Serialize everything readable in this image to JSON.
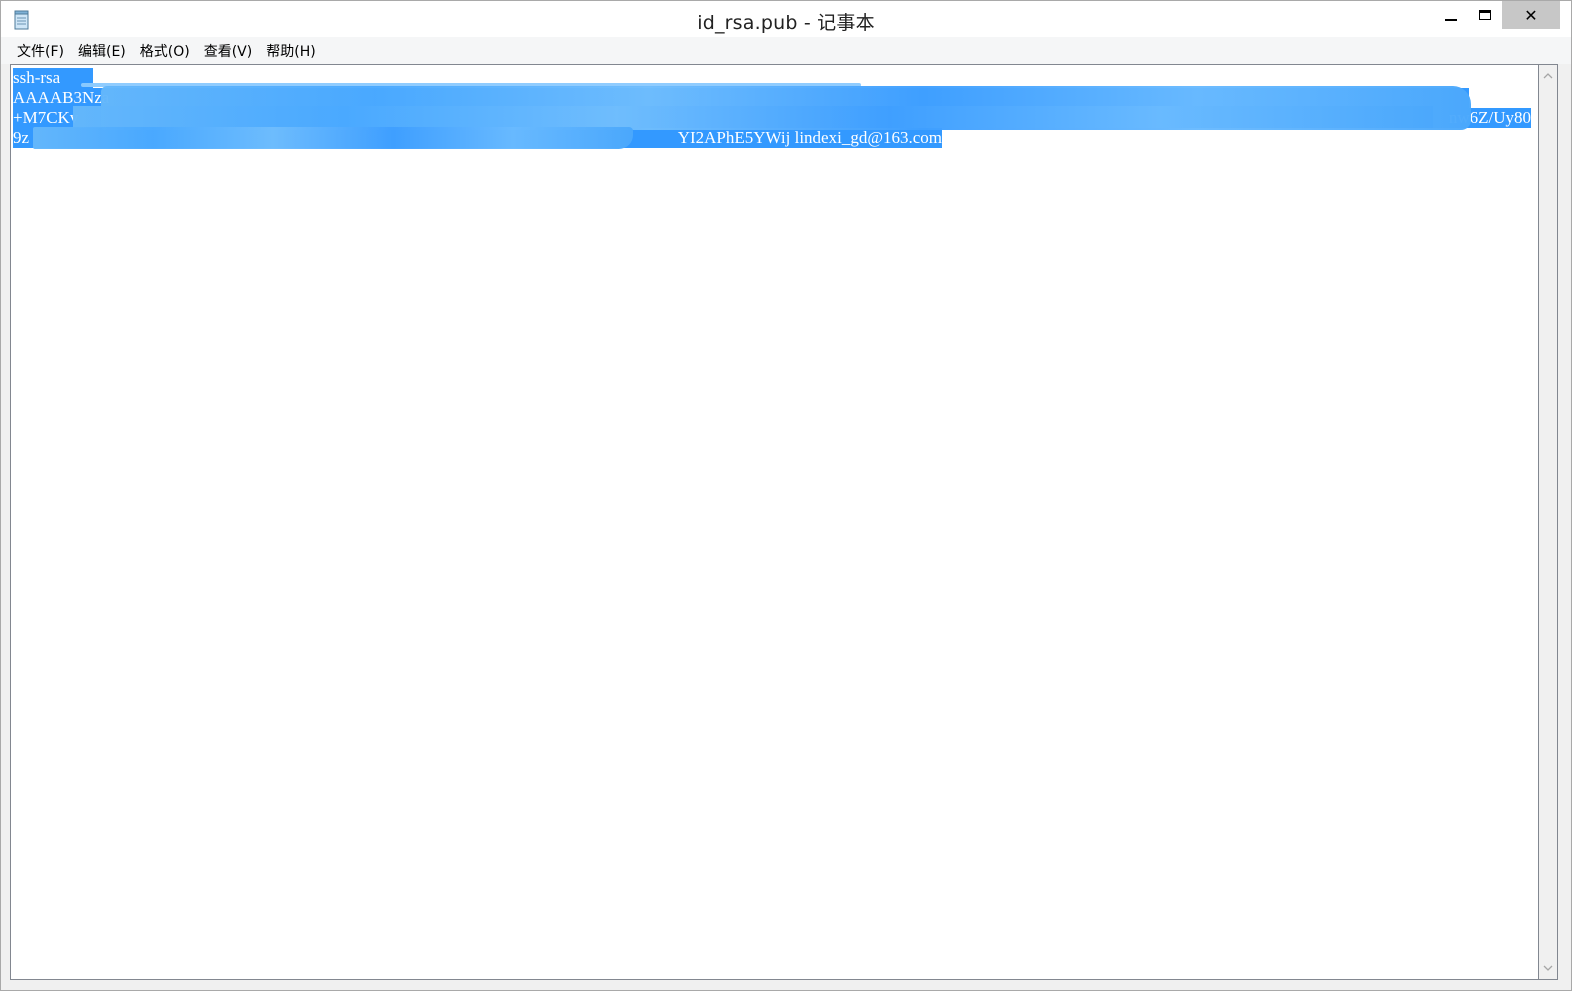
{
  "window": {
    "title": "id_rsa.pub - 记事本",
    "icon": "notepad-icon",
    "controls": {
      "minimize_icon": "minimize-icon",
      "maximize_icon": "maximize-icon",
      "close_label": "✕"
    }
  },
  "menu": {
    "items": [
      {
        "label": "文件(F)"
      },
      {
        "label": "编辑(E)"
      },
      {
        "label": "格式(O)"
      },
      {
        "label": "查看(V)"
      },
      {
        "label": "帮助(H)"
      }
    ]
  },
  "editor": {
    "lines": [
      {
        "left": "ssh-rsa",
        "right": ""
      },
      {
        "left": "AAAAB3Nza",
        "right": ""
      },
      {
        "left": "+M7CKv",
        "right": "nw6Z/Uy80"
      },
      {
        "left": "9z",
        "right": "YI2APhE5YWij lindexi_gd@163.com"
      }
    ],
    "selection_color": "#3399ff"
  },
  "colors": {
    "accent": "#3399ff",
    "close_hover": "#c7c7c7"
  }
}
